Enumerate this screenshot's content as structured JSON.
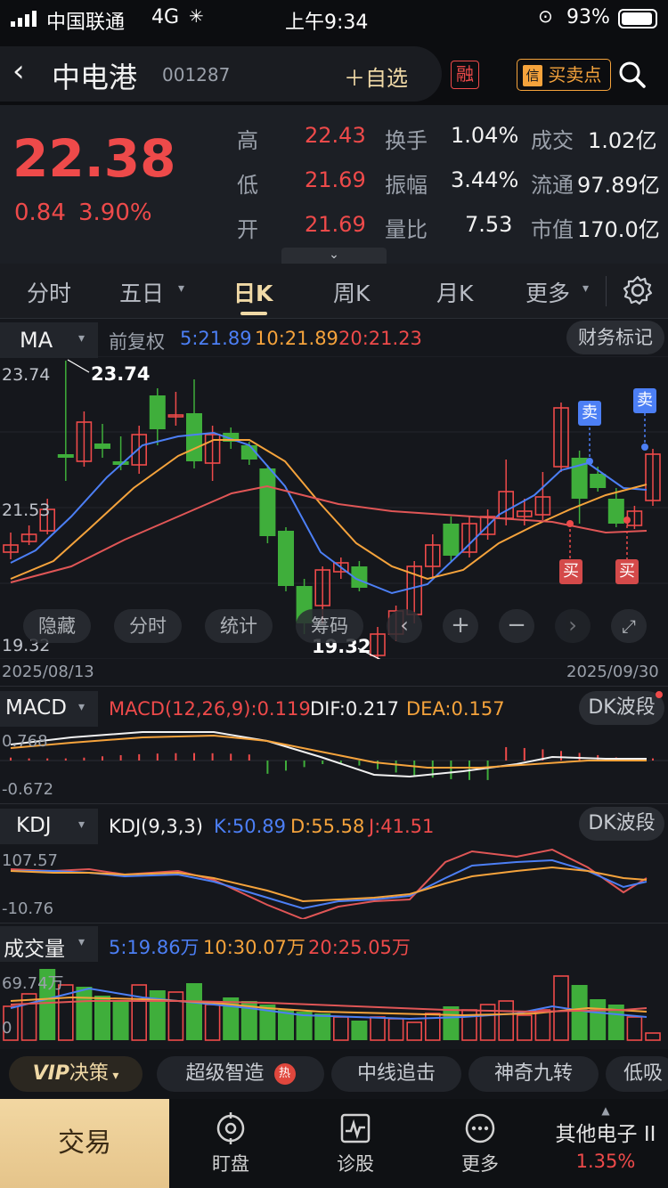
{
  "status_bar": {
    "carrier": "中国联通",
    "network": "4G",
    "time": "上午9:34",
    "battery": "93%"
  },
  "header": {
    "stock_name": "中电港",
    "stock_code": "001287",
    "add_watch": "自选",
    "rong_badge": "融",
    "xin_badge": "信",
    "buy_sell_points": "买卖点"
  },
  "quote": {
    "price": "22.38",
    "change": "0.84",
    "change_pct": "3.90%",
    "high_label": "高",
    "high": "22.43",
    "low_label": "低",
    "low": "21.69",
    "open_label": "开",
    "open": "21.69",
    "turnover_label": "换手",
    "turnover": "1.04%",
    "amplitude_label": "振幅",
    "amplitude": "3.44%",
    "vol_ratio_label": "量比",
    "vol_ratio": "7.53",
    "amount_label": "成交",
    "amount": "1.02亿",
    "float_label": "流通",
    "float": "97.89亿",
    "mcap_label": "市值",
    "mcap": "170.0亿"
  },
  "tabs": [
    "分时",
    "五日",
    "日K",
    "周K",
    "月K",
    "更多"
  ],
  "active_tab": "日K",
  "main_chart": {
    "indicator": "MA",
    "adjust": "前复权",
    "ma5": "5:21.89",
    "ma10": "10:21.89",
    "ma20": "20:21.23",
    "fin_marks": "财务标记",
    "y_top": "23.74",
    "y_mid": "21.53",
    "y_bottom": "19.32",
    "high_mark": "23.74",
    "low_mark": "19.32",
    "date_start": "2025/08/13",
    "date_end": "2025/09/30",
    "sell_label": "卖",
    "buy_label": "买",
    "toolbar": {
      "hide": "隐藏",
      "timeshare": "分时",
      "stats": "统计",
      "chips": "筹码"
    }
  },
  "macd": {
    "name": "MACD",
    "params": "MACD(12,26,9):0.119",
    "dif": "DIF:0.217",
    "dea": "DEA:0.157",
    "y_top": "0.768",
    "y_bottom": "-0.672",
    "dk": "DK波段"
  },
  "kdj": {
    "name": "KDJ",
    "params": "KDJ(9,3,3)",
    "k": "K:50.89",
    "d": "D:55.58",
    "j": "J:41.51",
    "y_top": "107.57",
    "y_bottom": "-10.76",
    "dk": "DK波段"
  },
  "volume": {
    "name": "成交量",
    "ma5": "5:19.86万",
    "ma10": "10:30.07万",
    "ma20": "20:25.05万",
    "y_top": "69.74万",
    "y_bottom": "0"
  },
  "strategies": {
    "vip": "VIP",
    "vip_label": "决策",
    "items": [
      "超级智造",
      "中线追击",
      "神奇九转",
      "低吸"
    ],
    "hot": "热"
  },
  "bottom_nav": {
    "trade": "交易",
    "watch": "盯盘",
    "diagnose": "诊股",
    "more": "更多",
    "sector": "其他电子 II",
    "sector_pct": "1.35%"
  },
  "colors": {
    "up": "#ee4a4a",
    "down": "#3fae3b",
    "ma5": "#4c7ff5",
    "ma10": "#f5a33c",
    "ma20": "#e05656",
    "accent": "#f5a33c"
  }
}
